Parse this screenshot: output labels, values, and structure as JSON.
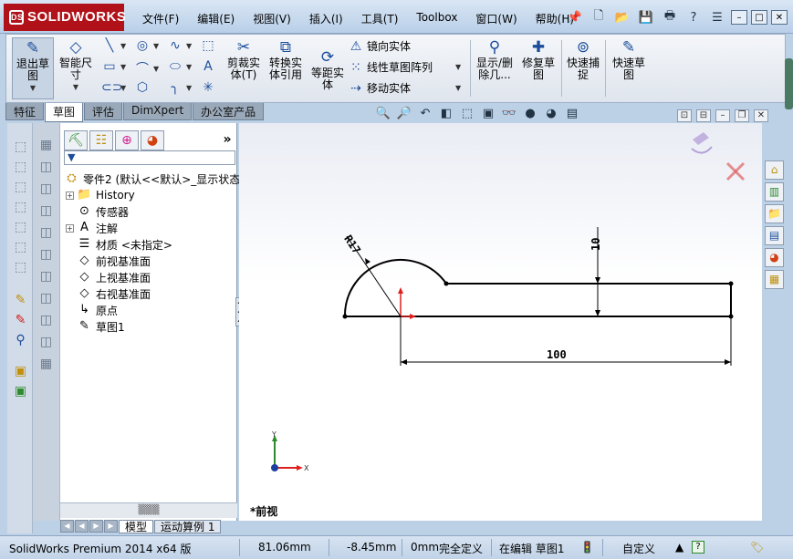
{
  "app": {
    "logo_text": "SOLIDWORKS",
    "logo_mark": "DS"
  },
  "menu": [
    "文件(F)",
    "编辑(E)",
    "视图(V)",
    "插入(I)",
    "工具(T)",
    "Toolbox",
    "窗口(W)",
    "帮助(H)"
  ],
  "ribbon": {
    "exit_sketch": "退出草\n图",
    "smart_dimension": "智能尺\n寸",
    "trim": "剪裁实\n体(T)",
    "convert": "转换实\n体引用",
    "offset": "等距实\n体",
    "mirror": "镜向实体",
    "linear_pattern": "线性草图阵列",
    "move": "移动实体",
    "show_delete": "显示/删\n除几...",
    "repair": "修复草\n图",
    "quick_snap": "快速捕\n捉",
    "rapid_sketch": "快速草\n图"
  },
  "tabs": [
    {
      "label": "特征",
      "active": false
    },
    {
      "label": "草图",
      "active": true
    },
    {
      "label": "评估",
      "active": false
    },
    {
      "label": "DimXpert",
      "active": false
    },
    {
      "label": "办公室产品",
      "active": false
    }
  ],
  "tree": {
    "root": "零件2 (默认<<默认>_显示状态",
    "items": [
      {
        "label": "History",
        "icon": "history-icon",
        "glyph": "📁",
        "expand": "+"
      },
      {
        "label": "传感器",
        "icon": "sensor-icon",
        "glyph": "⊙",
        "expand": ""
      },
      {
        "label": "注解",
        "icon": "annotation-icon",
        "glyph": "A",
        "expand": "+"
      },
      {
        "label": "材质 <未指定>",
        "icon": "material-icon",
        "glyph": "☰",
        "expand": ""
      },
      {
        "label": "前视基准面",
        "icon": "plane-icon",
        "glyph": "◇",
        "expand": ""
      },
      {
        "label": "上视基准面",
        "icon": "plane-icon",
        "glyph": "◇",
        "expand": ""
      },
      {
        "label": "右视基准面",
        "icon": "plane-icon",
        "glyph": "◇",
        "expand": ""
      },
      {
        "label": "原点",
        "icon": "origin-icon",
        "glyph": "↳",
        "expand": ""
      },
      {
        "label": "草图1",
        "icon": "sketch-icon",
        "glyph": "✎",
        "expand": ""
      }
    ]
  },
  "sketch": {
    "dim_radius": "R17",
    "dim_height": "10",
    "dim_length": "100",
    "view_label": "*前视",
    "axis_x": "X",
    "axis_y": "Y"
  },
  "bottom_tabs": [
    "模型",
    "运动算例 1"
  ],
  "status": {
    "product": "SolidWorks Premium 2014 x64 版",
    "x": "81.06mm",
    "y": "-8.45mm",
    "z": "0mm",
    "define_state": "完全定义",
    "edit_state": "在编辑 草图1",
    "custom": "自定义",
    "help": "?"
  },
  "colors": {
    "accent_red": "#b1121a",
    "sketch_red": "#e02020",
    "sketch_blue": "#1c3fa0"
  }
}
